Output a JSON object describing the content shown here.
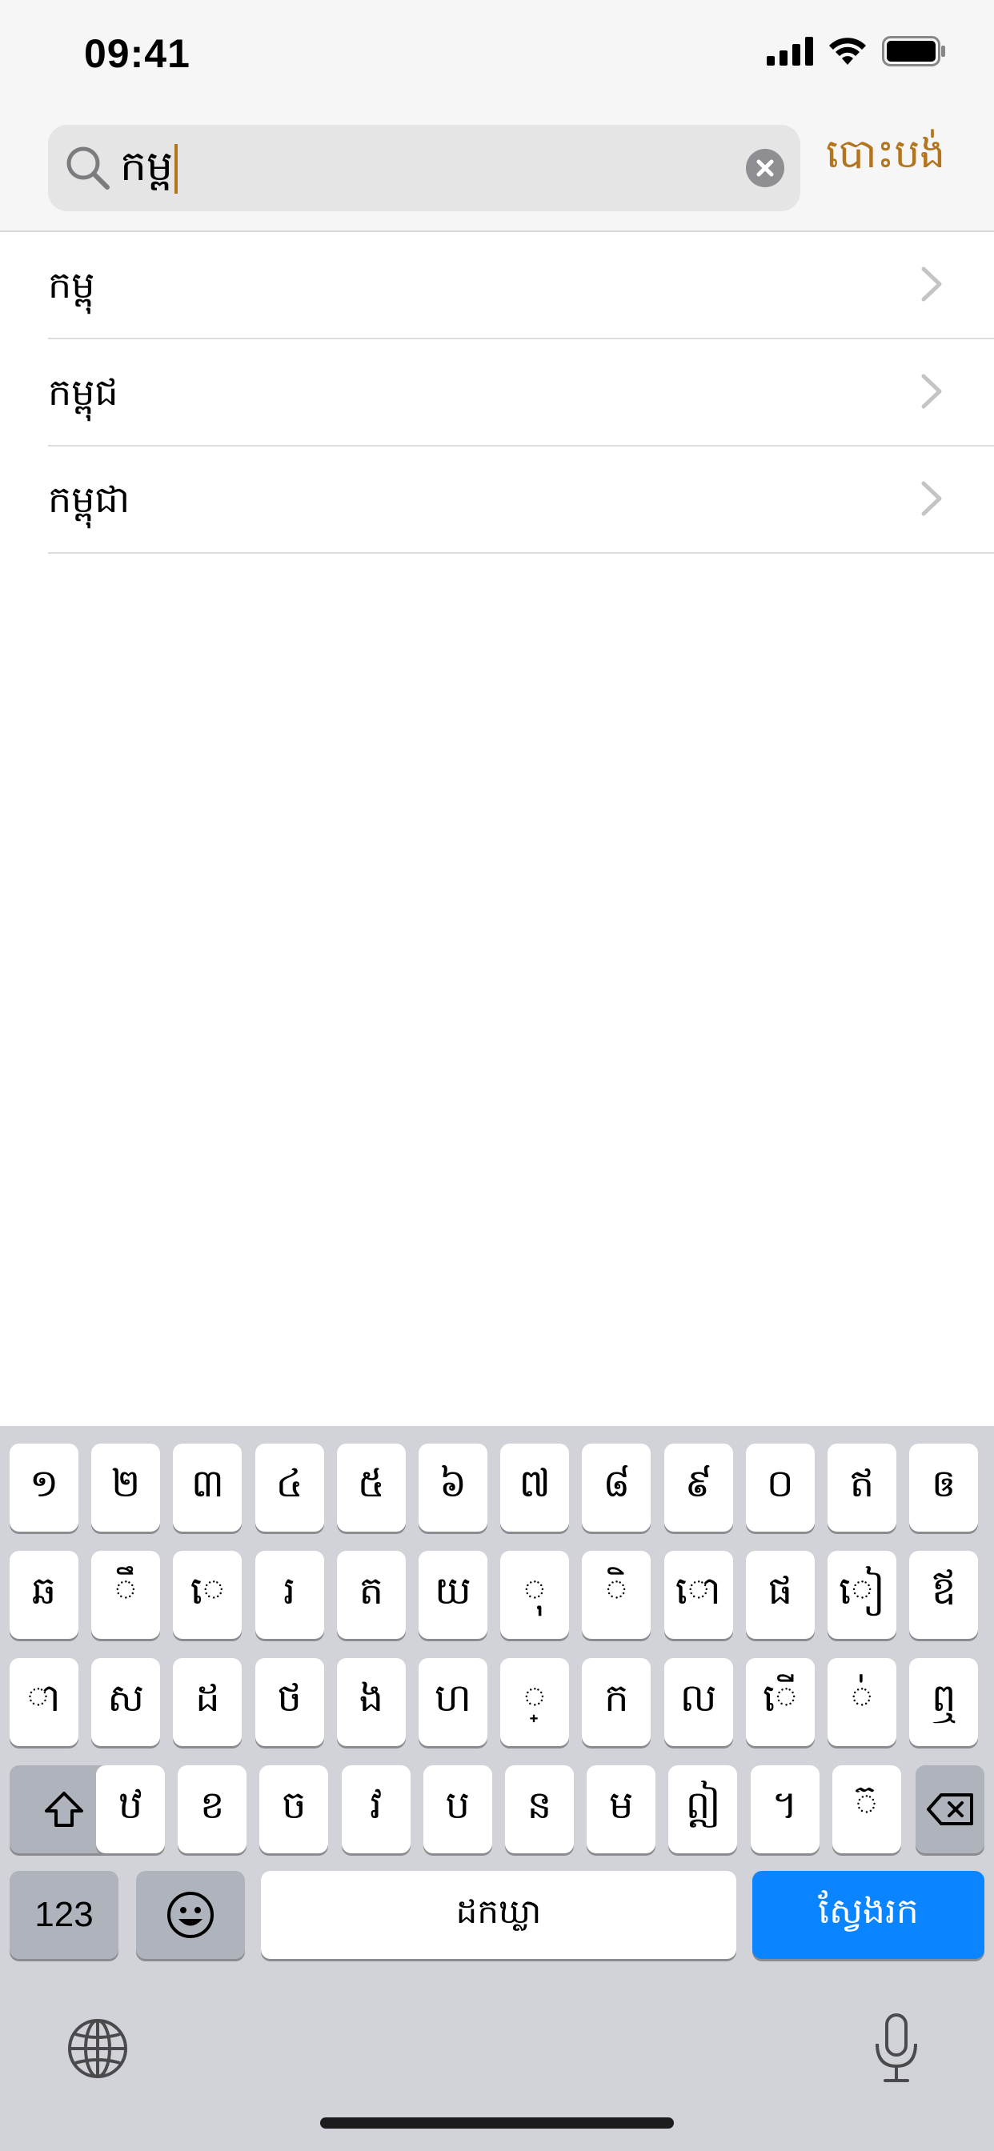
{
  "status": {
    "time": "09:41"
  },
  "search": {
    "query": "កម្ព",
    "cancel_label": "បោះបង់"
  },
  "results": [
    {
      "label": "កម្ពុ"
    },
    {
      "label": "កម្ពុជ"
    },
    {
      "label": "កម្ពុជា"
    }
  ],
  "keyboard": {
    "row1": [
      "១",
      "២",
      "៣",
      "៤",
      "៥",
      "៦",
      "៧",
      "៨",
      "៩",
      "០",
      "ឥ",
      "ឲ"
    ],
    "row2": [
      "ឆ",
      "ឹ",
      "េ",
      "រ",
      "ត",
      "យ",
      "ុ",
      "ិ",
      "ោ",
      "ផ",
      "ៀ",
      "ឪ"
    ],
    "row3": [
      "ា",
      "ស",
      "ដ",
      "ថ",
      "ង",
      "ហ",
      "្",
      "ក",
      "ល",
      "ើ",
      "់",
      "ឮ"
    ],
    "row4": [
      "ឋ",
      "ខ",
      "ច",
      "វ",
      "ប",
      "ន",
      "ម",
      "ឦ",
      "។",
      "៊"
    ],
    "numbers_label": "123",
    "space_label": "ដកឃ្លា",
    "search_label": "ស្វែងរក"
  },
  "colors": {
    "accent": "#b3741e",
    "search_key": "#0a84ff"
  }
}
